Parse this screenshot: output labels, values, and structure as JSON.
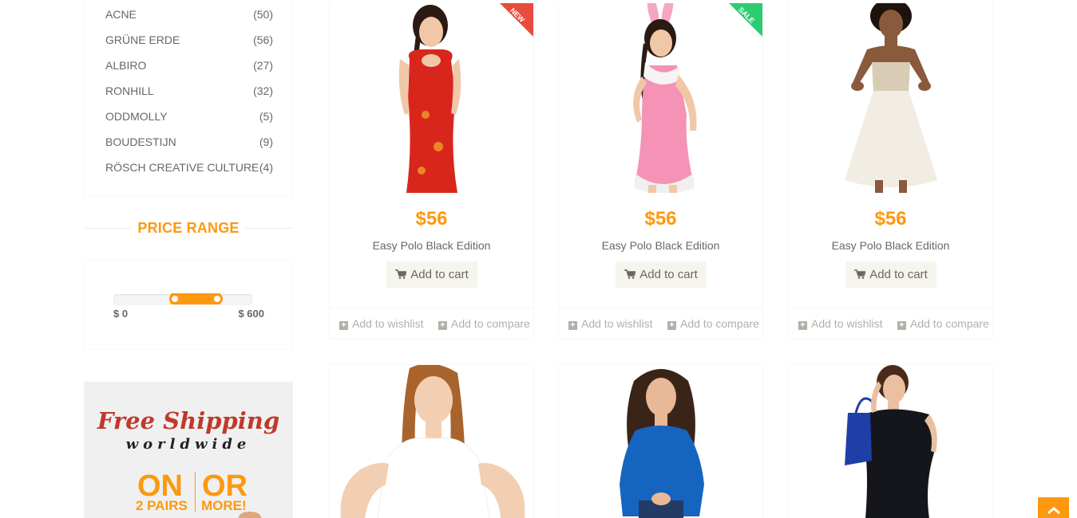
{
  "brands": [
    {
      "name": "ACNE",
      "count": "(50)"
    },
    {
      "name": "GRÜNE ERDE",
      "count": "(56)"
    },
    {
      "name": "ALBIRO",
      "count": "(27)"
    },
    {
      "name": "RONHILL",
      "count": "(32)"
    },
    {
      "name": "ODDMOLLY",
      "count": "(5)"
    },
    {
      "name": "BOUDESTIJN",
      "count": "(9)"
    },
    {
      "name": "RÖSCH CREATIVE CULTURE",
      "count": "(4)"
    }
  ],
  "price_range": {
    "title": "PRICE RANGE",
    "min_label": "$ 0",
    "max_label": "$ 600",
    "selected_low_fraction": 0.45,
    "selected_high_fraction": 0.75
  },
  "shipping_banner": {
    "line1": "Free Shipping",
    "line2": "worldwide",
    "left_big": "ON",
    "left_small": "2 PAIRS",
    "right_big": "OR",
    "right_small": "MORE!"
  },
  "products": [
    {
      "price": "$56",
      "name": "Easy Polo Black Edition",
      "cart": "Add to cart",
      "wishlist": "Add to wishlist",
      "compare": "Add to compare",
      "badge": "NEW"
    },
    {
      "price": "$56",
      "name": "Easy Polo Black Edition",
      "cart": "Add to cart",
      "wishlist": "Add to wishlist",
      "compare": "Add to compare",
      "badge": "SALE"
    },
    {
      "price": "$56",
      "name": "Easy Polo Black Edition",
      "cart": "Add to cart",
      "wishlist": "Add to wishlist",
      "compare": "Add to compare",
      "badge": ""
    }
  ],
  "icons": {
    "cart": "shopping-cart-icon",
    "plus": "plus-square-icon",
    "scroll_up": "chevron-up-icon"
  },
  "colors": {
    "accent": "#fe980f",
    "new_badge": "#e74c3c",
    "sale_badge": "#2ecc71",
    "text": "#696763"
  }
}
